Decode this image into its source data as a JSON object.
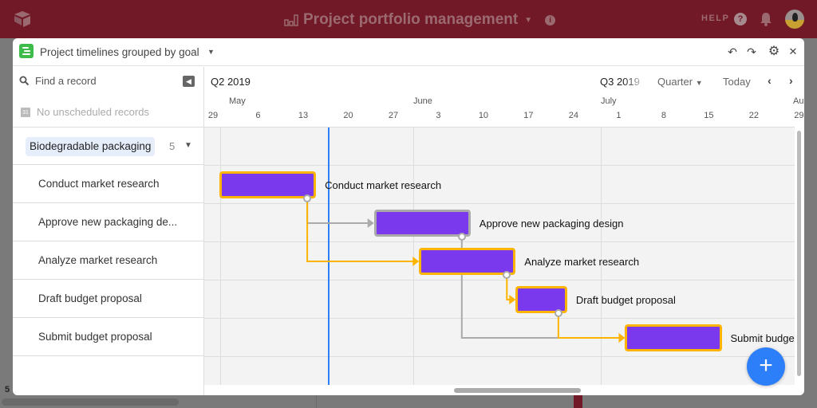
{
  "app": {
    "base_title": "Project portfolio management",
    "help_label": "HELP"
  },
  "view": {
    "title": "Project timelines grouped by goal"
  },
  "sidebar": {
    "search_placeholder": "Find a record",
    "unscheduled_text": "No unscheduled records",
    "group": {
      "label": "Biodegradable packaging",
      "count": "5"
    },
    "records": [
      {
        "name": "Conduct market research"
      },
      {
        "name": "Approve new packaging de..."
      },
      {
        "name": "Analyze market research"
      },
      {
        "name": "Draft budget proposal"
      },
      {
        "name": "Submit budget proposal"
      }
    ]
  },
  "timeline": {
    "quarters": [
      "Q2 2019",
      "Q3 2019"
    ],
    "zoom_level": "Quarter",
    "today_label": "Today",
    "months": [
      "May",
      "June",
      "July",
      "Au"
    ],
    "week_ticks": [
      "29",
      "6",
      "13",
      "20",
      "27",
      "3",
      "10",
      "17",
      "24",
      "1",
      "8",
      "15",
      "22",
      "29"
    ],
    "today_marker_date": "May 17, 2019",
    "tasks": [
      {
        "name": "Conduct market research",
        "start": "Apr 30",
        "end": "May 15",
        "highlight": "critical"
      },
      {
        "name": "Approve new packaging design",
        "start": "May 24",
        "end": "Jun 8",
        "highlight": "normal"
      },
      {
        "name": "Analyze market research",
        "start": "May 31",
        "end": "Jun 15",
        "highlight": "critical"
      },
      {
        "name": "Draft budget proposal",
        "start": "Jun 15",
        "end": "Jun 23",
        "highlight": "critical"
      },
      {
        "name": "Submit budget proposal",
        "start": "Jul 2",
        "end": "Jul 17",
        "highlight": "critical"
      }
    ],
    "dependencies": [
      {
        "from": 0,
        "to": 1,
        "critical": false
      },
      {
        "from": 0,
        "to": 2,
        "critical": true
      },
      {
        "from": 2,
        "to": 3,
        "critical": true
      },
      {
        "from": 1,
        "to": 4,
        "critical": false
      },
      {
        "from": 3,
        "to": 4,
        "critical": true
      }
    ]
  },
  "colors": {
    "topbar": "#711926",
    "bar_fill": "#7b39ed",
    "critical": "#fcb400",
    "today_line": "#2d7ff9",
    "fab": "#2d7ff9",
    "view_icon": "#3dbc4a"
  },
  "icons": {
    "fab": "+",
    "undo": "↶",
    "redo": "↷",
    "settings": "⚙",
    "close": "✕",
    "prev": "‹",
    "next": "›"
  }
}
